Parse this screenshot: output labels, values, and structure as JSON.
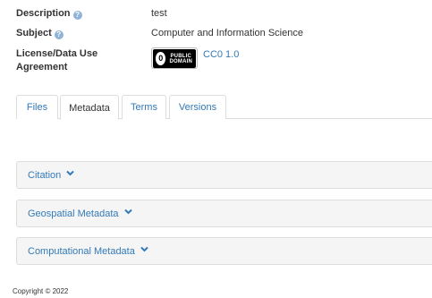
{
  "metadata_fields": {
    "description": {
      "label": "Description",
      "value": "test"
    },
    "subject": {
      "label": "Subject",
      "value": "Computer and Information Science"
    },
    "license": {
      "label_line1": "License/Data Use",
      "label_line2": "Agreement",
      "badge_line1": "PUBLIC",
      "badge_line2": "DOMAIN",
      "badge_symbol": "0",
      "link_text": "CC0 1.0"
    }
  },
  "tabs": [
    {
      "label": "Files",
      "active": false
    },
    {
      "label": "Metadata",
      "active": true
    },
    {
      "label": "Terms",
      "active": false
    },
    {
      "label": "Versions",
      "active": false
    }
  ],
  "panels": [
    {
      "label": "Citation"
    },
    {
      "label": "Geospatial Metadata"
    },
    {
      "label": "Computational Metadata"
    }
  ],
  "footer": {
    "copyright": "Copyright © 2022"
  },
  "colors": {
    "link": "#337ab7",
    "panel_bg": "#f5f5f5",
    "border": "#dddddd",
    "help_icon": "#8fb4d8"
  }
}
